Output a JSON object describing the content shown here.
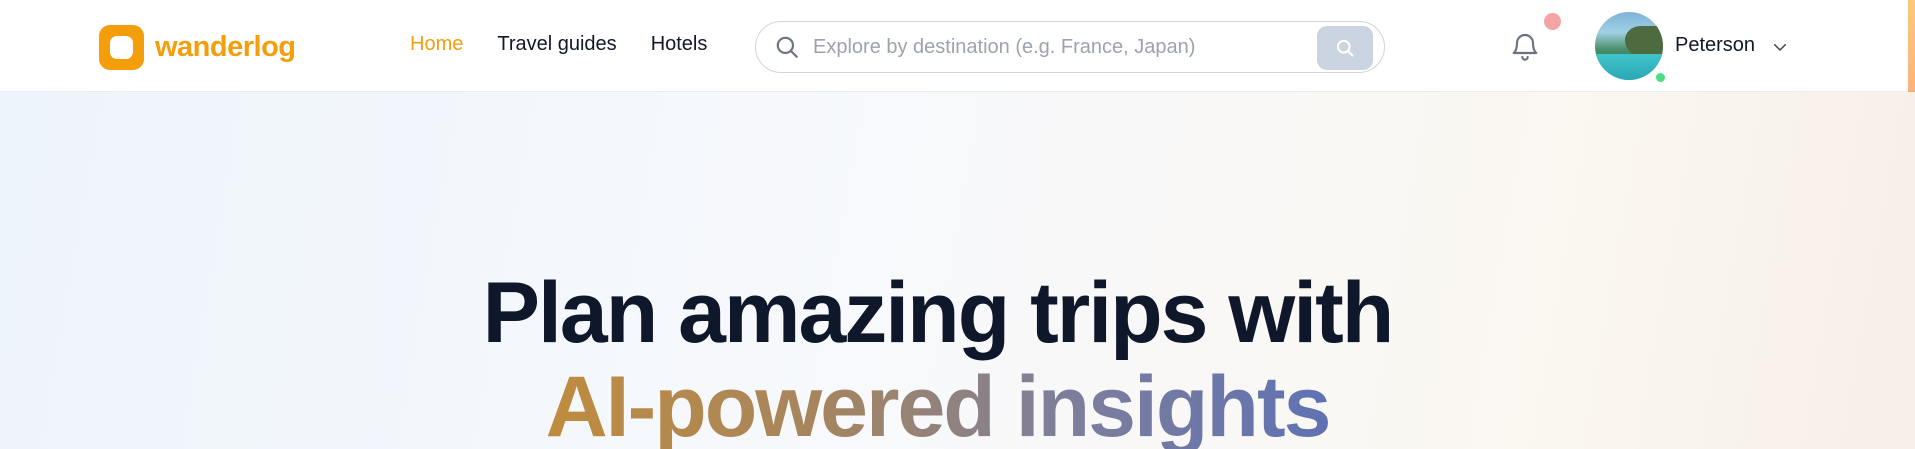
{
  "brand": {
    "name": "wanderlog",
    "color": "#f59e0b"
  },
  "nav": {
    "items": [
      {
        "label": "Home",
        "active": true
      },
      {
        "label": "Travel guides",
        "active": false
      },
      {
        "label": "Hotels",
        "active": false
      }
    ]
  },
  "search": {
    "placeholder": "Explore by destination (e.g. France, Japan)",
    "value": "",
    "icon": "search-icon",
    "button_icon": "search-icon"
  },
  "notifications": {
    "icon": "bell-icon",
    "has_unread": true
  },
  "user": {
    "name": "Peterson",
    "online": true,
    "menu_icon": "chevron-down-icon"
  },
  "hero": {
    "line1": "Plan amazing trips with",
    "line2": "AI-powered insights"
  },
  "colors": {
    "accent": "#f59e0b",
    "text": "#111827",
    "online": "#4ade80",
    "notification": "#f4a4a4"
  }
}
